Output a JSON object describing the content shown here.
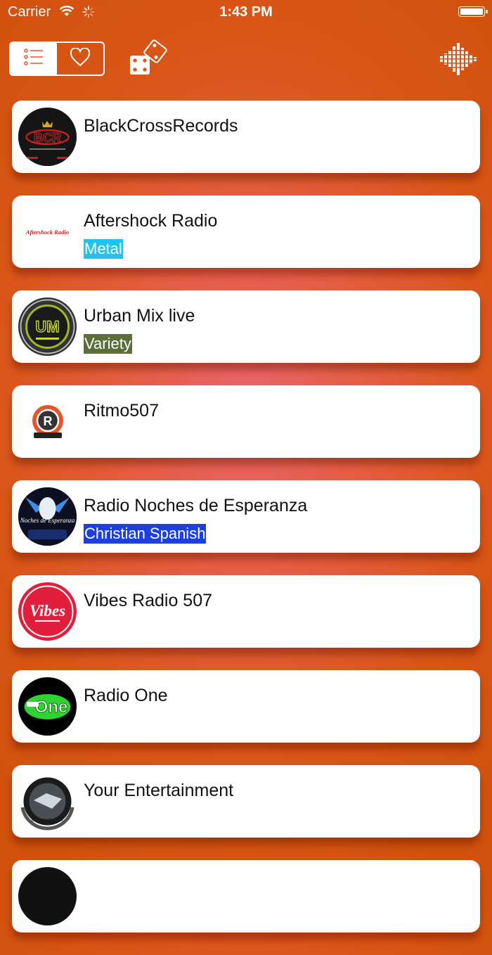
{
  "status_bar": {
    "carrier": "Carrier",
    "time": "1:43 PM"
  },
  "toolbar": {
    "list_view_icon": "list-icon",
    "favorites_icon": "heart-icon",
    "random_icon": "dice-icon",
    "now_playing_icon": "equalizer-icon"
  },
  "stations": [
    {
      "name": "BlackCrossRecords",
      "genre": "",
      "logo_text": "BCR"
    },
    {
      "name": "Aftershock Radio",
      "genre": "Metal",
      "genre_bg": "#1ec3ee",
      "genre_color": "#ffffff",
      "logo_text": "Aftershock Radio"
    },
    {
      "name": "Urban Mix live",
      "genre": "Variety",
      "genre_bg": "#5c6f3a",
      "genre_color": "#ffffff",
      "logo_text": "UM"
    },
    {
      "name": "Ritmo507",
      "genre": "",
      "logo_text": "R"
    },
    {
      "name": "Radio Noches de Esperanza",
      "genre": "Christian Spanish",
      "genre_bg": "#1d3fe0",
      "genre_color": "#ffffff",
      "logo_text": "Noches de Esperanza"
    },
    {
      "name": "Vibes Radio 507",
      "genre": "",
      "logo_text": "Vibes"
    },
    {
      "name": "Radio One",
      "genre": "",
      "logo_text": "One"
    },
    {
      "name": "Your Entertainment",
      "genre": "",
      "logo_text": "Entertainment"
    }
  ]
}
